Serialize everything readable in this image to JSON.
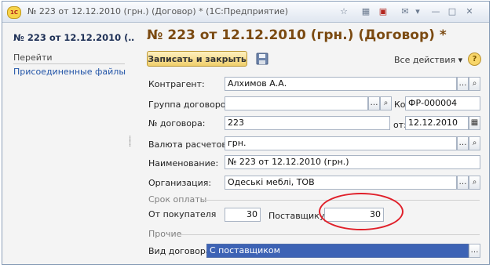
{
  "window": {
    "title": "№ 223 от 12.12.2010 (грн.) (Договор) * (1С:Предприятие)",
    "app_icon": "1С"
  },
  "sidebar": {
    "title": "№ 223 от 12.12.2010 (…",
    "section": "Перейти",
    "items": [
      {
        "label": "Присоединенные файлы"
      }
    ]
  },
  "form": {
    "heading": "№ 223 от 12.12.2010 (грн.) (Договор) *",
    "save_close_label": "Записать и закрыть",
    "all_actions_label": "Все действия ▾",
    "help_label": "?",
    "fields": {
      "counterparty": {
        "label": "Контрагент:",
        "value": "Алхимов А.А."
      },
      "contract_group": {
        "label": "Группа договоров:",
        "value": ""
      },
      "code": {
        "label": "Код:",
        "value": "ФР-000004"
      },
      "contract_number": {
        "label": "№ договора:",
        "value": "223"
      },
      "date": {
        "label": "от:",
        "value": "12.12.2010"
      },
      "currency": {
        "label": "Валюта расчетов:",
        "value": "грн."
      },
      "name": {
        "label": "Наименование:",
        "value": "№ 223 от 12.12.2010 (грн.)"
      },
      "organization": {
        "label": "Организация:",
        "value": "Одеські меблі, ТОВ"
      }
    },
    "payment_section": {
      "title": "Срок оплаты",
      "from_buyer": {
        "label": "От покупателя",
        "value": "30"
      },
      "to_supplier": {
        "label": "Поставщику:",
        "value": "30"
      }
    },
    "other_section": {
      "title": "Прочие",
      "contract_type": {
        "label": "Вид договора:",
        "value": "С поставщиком"
      }
    }
  },
  "colors": {
    "heading": "#7b4a11",
    "link": "#2355a8",
    "highlight_circle": "#e0202a",
    "selection": "#3d63b5"
  }
}
